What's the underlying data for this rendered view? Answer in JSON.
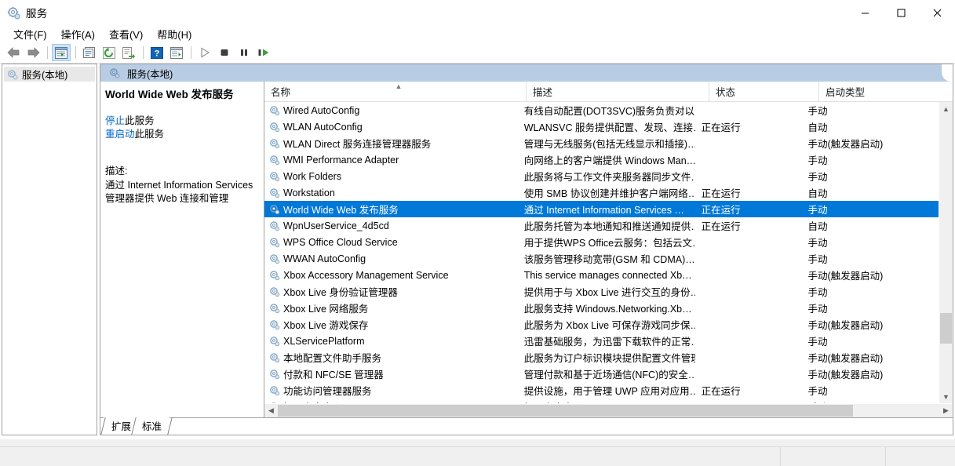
{
  "window": {
    "title": "服务",
    "icon": "services-gear-icon",
    "minimize_label": "最小化",
    "maximize_label": "最大化",
    "close_label": "关闭"
  },
  "menubar": {
    "items": [
      {
        "label": "文件(F)",
        "name": "menu-file"
      },
      {
        "label": "操作(A)",
        "name": "menu-action"
      },
      {
        "label": "查看(V)",
        "name": "menu-view"
      },
      {
        "label": "帮助(H)",
        "name": "menu-help"
      }
    ]
  },
  "toolbar": {
    "buttons": [
      {
        "name": "back-button",
        "icon": "arrow-left-icon",
        "pressed": false
      },
      {
        "name": "forward-button",
        "icon": "arrow-right-icon",
        "pressed": false
      },
      {
        "name": "show-hide-tree-button",
        "icon": "tree-pane-icon",
        "pressed": true
      },
      {
        "name": "properties-button",
        "icon": "properties-icon",
        "pressed": false
      },
      {
        "name": "refresh-button",
        "icon": "refresh-icon",
        "pressed": false
      },
      {
        "name": "export-list-button",
        "icon": "export-list-icon",
        "pressed": false
      },
      {
        "name": "help-button",
        "icon": "help-question-icon",
        "pressed": false
      },
      {
        "name": "show-action-pane-button",
        "icon": "action-pane-icon",
        "pressed": false
      },
      {
        "name": "start-service-button",
        "icon": "play-icon",
        "pressed": false
      },
      {
        "name": "stop-service-button",
        "icon": "stop-icon",
        "pressed": false
      },
      {
        "name": "pause-service-button",
        "icon": "pause-icon",
        "pressed": false
      },
      {
        "name": "restart-service-button",
        "icon": "restart-icon",
        "pressed": false
      }
    ]
  },
  "tree": {
    "root": {
      "label": "服务(本地)",
      "icon": "services-gear-icon"
    }
  },
  "pane": {
    "header": {
      "label": "服务(本地)",
      "icon": "services-gear-icon"
    }
  },
  "details": {
    "title": "World Wide Web 发布服务",
    "links": [
      {
        "name": "stop-service-link",
        "link_text": "停止",
        "suffix": "此服务"
      },
      {
        "name": "restart-service-link",
        "link_text": "重启动",
        "suffix": "此服务"
      }
    ],
    "description_label": "描述:",
    "description_line1": "通过 Internet Information Services",
    "description_line2": "管理器提供 Web 连接和管理"
  },
  "list": {
    "columns": [
      {
        "label": "名称",
        "name": "column-name",
        "sorted": "asc"
      },
      {
        "label": "描述",
        "name": "column-description"
      },
      {
        "label": "状态",
        "name": "column-status"
      },
      {
        "label": "启动类型",
        "name": "column-startup-type"
      }
    ],
    "rows": [
      {
        "name": "Wired AutoConfig",
        "description": "有线自动配置(DOT3SVC)服务负责对以…",
        "status": "",
        "startup": "手动",
        "selected": false
      },
      {
        "name": "WLAN AutoConfig",
        "description": "WLANSVC 服务提供配置、发现、连接…",
        "status": "正在运行",
        "startup": "自动",
        "selected": false
      },
      {
        "name": "WLAN Direct 服务连接管理器服务",
        "description": "管理与无线服务(包括无线显示和插接)…",
        "status": "",
        "startup": "手动(触发器启动)",
        "selected": false
      },
      {
        "name": "WMI Performance Adapter",
        "description": "向网络上的客户端提供 Windows Man…",
        "status": "",
        "startup": "手动",
        "selected": false
      },
      {
        "name": "Work Folders",
        "description": "此服务将与工作文件夹服务器同步文件…",
        "status": "",
        "startup": "手动",
        "selected": false
      },
      {
        "name": "Workstation",
        "description": "使用 SMB 协议创建并维护客户端网络…",
        "status": "正在运行",
        "startup": "自动",
        "selected": false
      },
      {
        "name": "World Wide Web 发布服务",
        "description": "通过 Internet Information Services …",
        "status": "正在运行",
        "startup": "手动",
        "selected": true
      },
      {
        "name": "WpnUserService_4d5cd",
        "description": "此服务托管为本地通知和推送通知提供…",
        "status": "正在运行",
        "startup": "自动",
        "selected": false
      },
      {
        "name": "WPS Office Cloud Service",
        "description": "用于提供WPS Office云服务：包括云文…",
        "status": "",
        "startup": "手动",
        "selected": false
      },
      {
        "name": "WWAN AutoConfig",
        "description": "该服务管理移动宽带(GSM 和 CDMA)…",
        "status": "",
        "startup": "手动",
        "selected": false
      },
      {
        "name": "Xbox Accessory Management Service",
        "description": "This service manages connected Xb…",
        "status": "",
        "startup": "手动(触发器启动)",
        "selected": false
      },
      {
        "name": "Xbox Live 身份验证管理器",
        "description": "提供用于与 Xbox Live 进行交互的身份…",
        "status": "",
        "startup": "手动",
        "selected": false
      },
      {
        "name": "Xbox Live 网络服务",
        "description": "此服务支持 Windows.Networking.Xb…",
        "status": "",
        "startup": "手动",
        "selected": false
      },
      {
        "name": "Xbox Live 游戏保存",
        "description": "此服务为 Xbox Live 可保存游戏同步保…",
        "status": "",
        "startup": "手动(触发器启动)",
        "selected": false
      },
      {
        "name": "XLServicePlatform",
        "description": "迅雷基础服务，为迅雷下载软件的正常…",
        "status": "",
        "startup": "手动",
        "selected": false
      },
      {
        "name": "本地配置文件助手服务",
        "description": "此服务为订户标识模块提供配置文件管理",
        "status": "",
        "startup": "手动(触发器启动)",
        "selected": false
      },
      {
        "name": "付款和 NFC/SE 管理器",
        "description": "管理付款和基于近场通信(NFC)的安全…",
        "status": "",
        "startup": "手动(触发器启动)",
        "selected": false
      },
      {
        "name": "功能访问管理器服务",
        "description": "提供设施，用于管理 UWP 应用对应用…",
        "status": "正在运行",
        "startup": "手动",
        "selected": false
      },
      {
        "name": "好压安全中心",
        "description": "好压安全中心",
        "status": "",
        "startup": "手动",
        "selected": false
      }
    ]
  },
  "scrollbars": {
    "vertical": {
      "up_label": "向上滚动",
      "down_label": "向下滚动",
      "thumb_top_pct": 72,
      "thumb_height_pct": 11
    },
    "horizontal": {
      "left_label": "向左滚动",
      "right_label": "向右滚动",
      "thumb_left_pct": 0,
      "thumb_width_pct": 87
    }
  },
  "tabs": [
    {
      "label": "扩展",
      "name": "tab-extended",
      "active": false
    },
    {
      "label": "标准",
      "name": "tab-standard",
      "active": true
    }
  ],
  "statusbar": {
    "segments": [
      "",
      "",
      ""
    ]
  },
  "colors": {
    "selection": "#0078d7",
    "pane_header": "#b8cce4",
    "link": "#0066cc",
    "toolbar_pressed": "#cce4f7"
  }
}
